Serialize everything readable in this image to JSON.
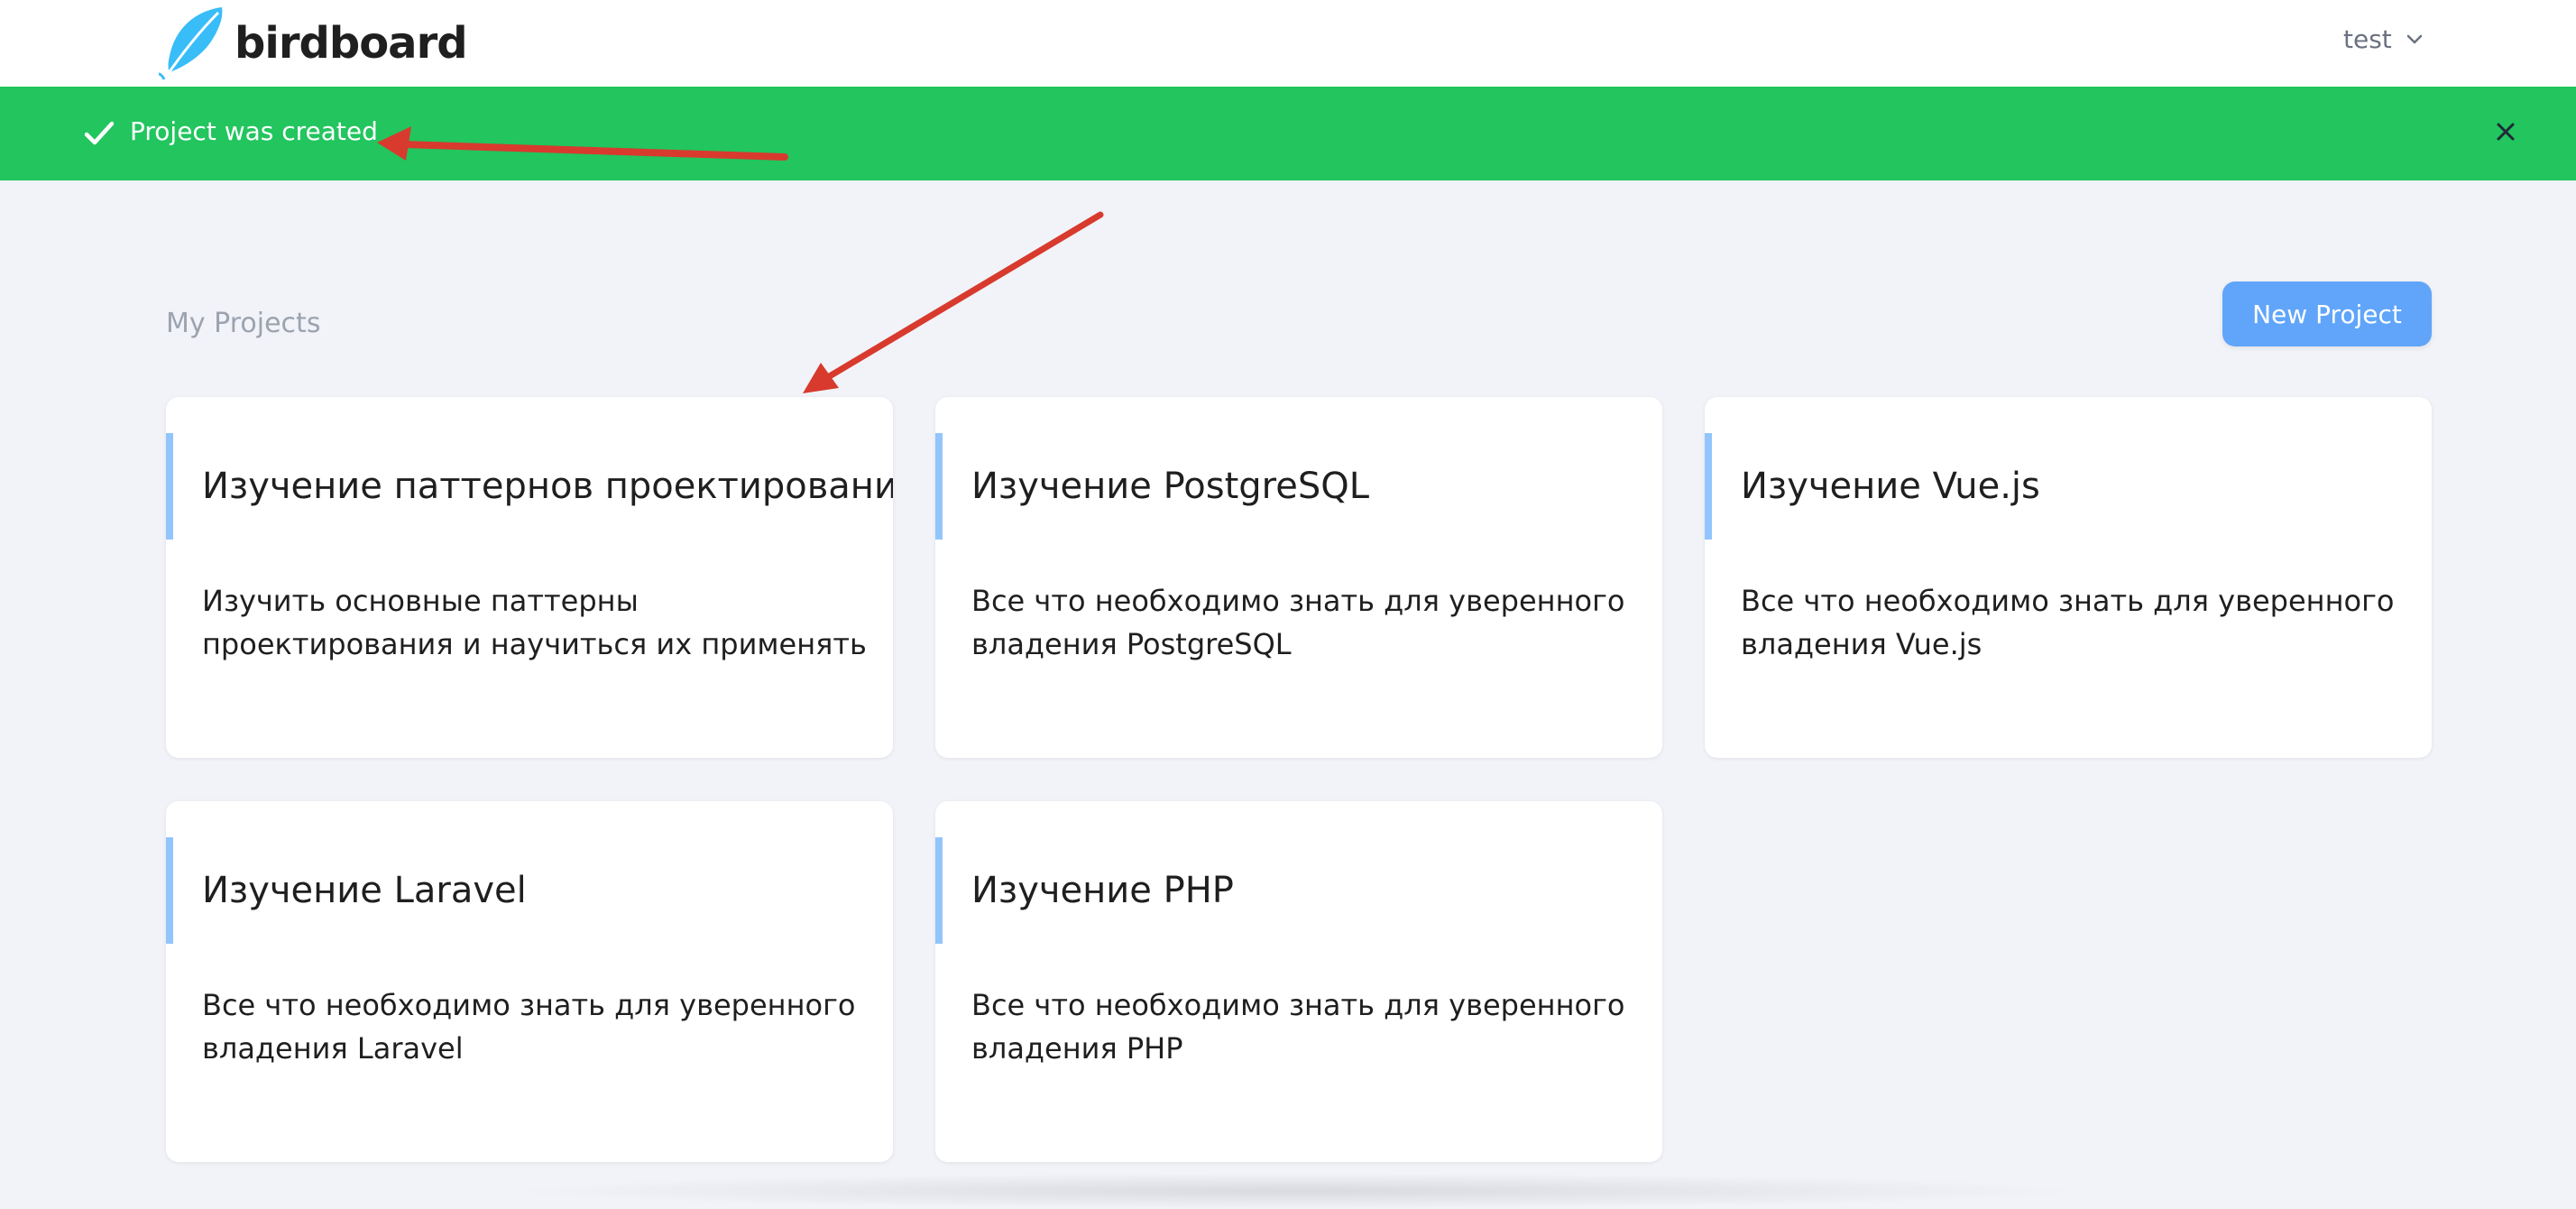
{
  "header": {
    "brand": "birdboard",
    "user_name": "test",
    "logo_color": "#38bdf8"
  },
  "flash": {
    "message": "Project was created",
    "color": "#22c55e"
  },
  "main": {
    "section_title": "My Projects",
    "new_project_label": "New Project",
    "accent_color": "#60a5fa",
    "projects": [
      {
        "title": "Изучение паттернов проектирования",
        "description": "Изучить основные паттерны проектирования и научиться их применять"
      },
      {
        "title": "Изучение PostgreSQL",
        "description": "Все что необходимо знать для уверенного владения PostgreSQL"
      },
      {
        "title": "Изучение Vue.js",
        "description": "Все что необходимо знать для уверенного владения Vue.js"
      },
      {
        "title": "Изучение Laravel",
        "description": "Все что необходимо знать для уверенного владения Laravel"
      },
      {
        "title": "Изучение PHP",
        "description": "Все что необходимо знать для уверенного владения PHP"
      }
    ]
  }
}
